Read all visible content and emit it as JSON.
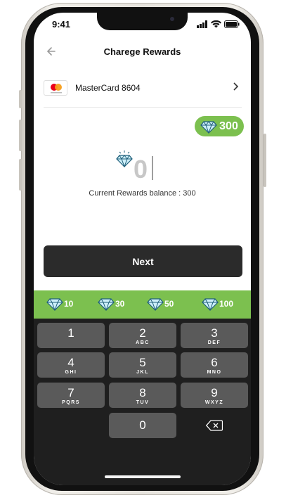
{
  "status": {
    "time": "9:41"
  },
  "header": {
    "title": "Charege Rewards"
  },
  "card": {
    "label": "MasterCard 8604"
  },
  "badge": {
    "value": "300"
  },
  "amount": {
    "value": "0",
    "balance_text": "Current Rewards balance : 300"
  },
  "next_label": "Next",
  "chips": [
    "10",
    "30",
    "50",
    "100"
  ],
  "keypad": [
    {
      "num": "1",
      "sub": ""
    },
    {
      "num": "2",
      "sub": "ABC"
    },
    {
      "num": "3",
      "sub": "DEF"
    },
    {
      "num": "4",
      "sub": "GHI"
    },
    {
      "num": "5",
      "sub": "JKL"
    },
    {
      "num": "6",
      "sub": "MNO"
    },
    {
      "num": "7",
      "sub": "PQRS"
    },
    {
      "num": "8",
      "sub": "TUV"
    },
    {
      "num": "9",
      "sub": "WXYZ"
    },
    {
      "num": "0",
      "sub": ""
    }
  ],
  "colors": {
    "accent_green": "#7cc04f",
    "dark_button": "#2b2b2b",
    "keyboard_bg": "#1f1f1f",
    "key_bg": "#5a5a5a"
  },
  "icons": [
    "back-arrow-icon",
    "mastercard-icon",
    "chevron-right-icon",
    "diamond-icon",
    "backspace-icon",
    "signal-icon",
    "wifi-icon",
    "battery-icon"
  ]
}
